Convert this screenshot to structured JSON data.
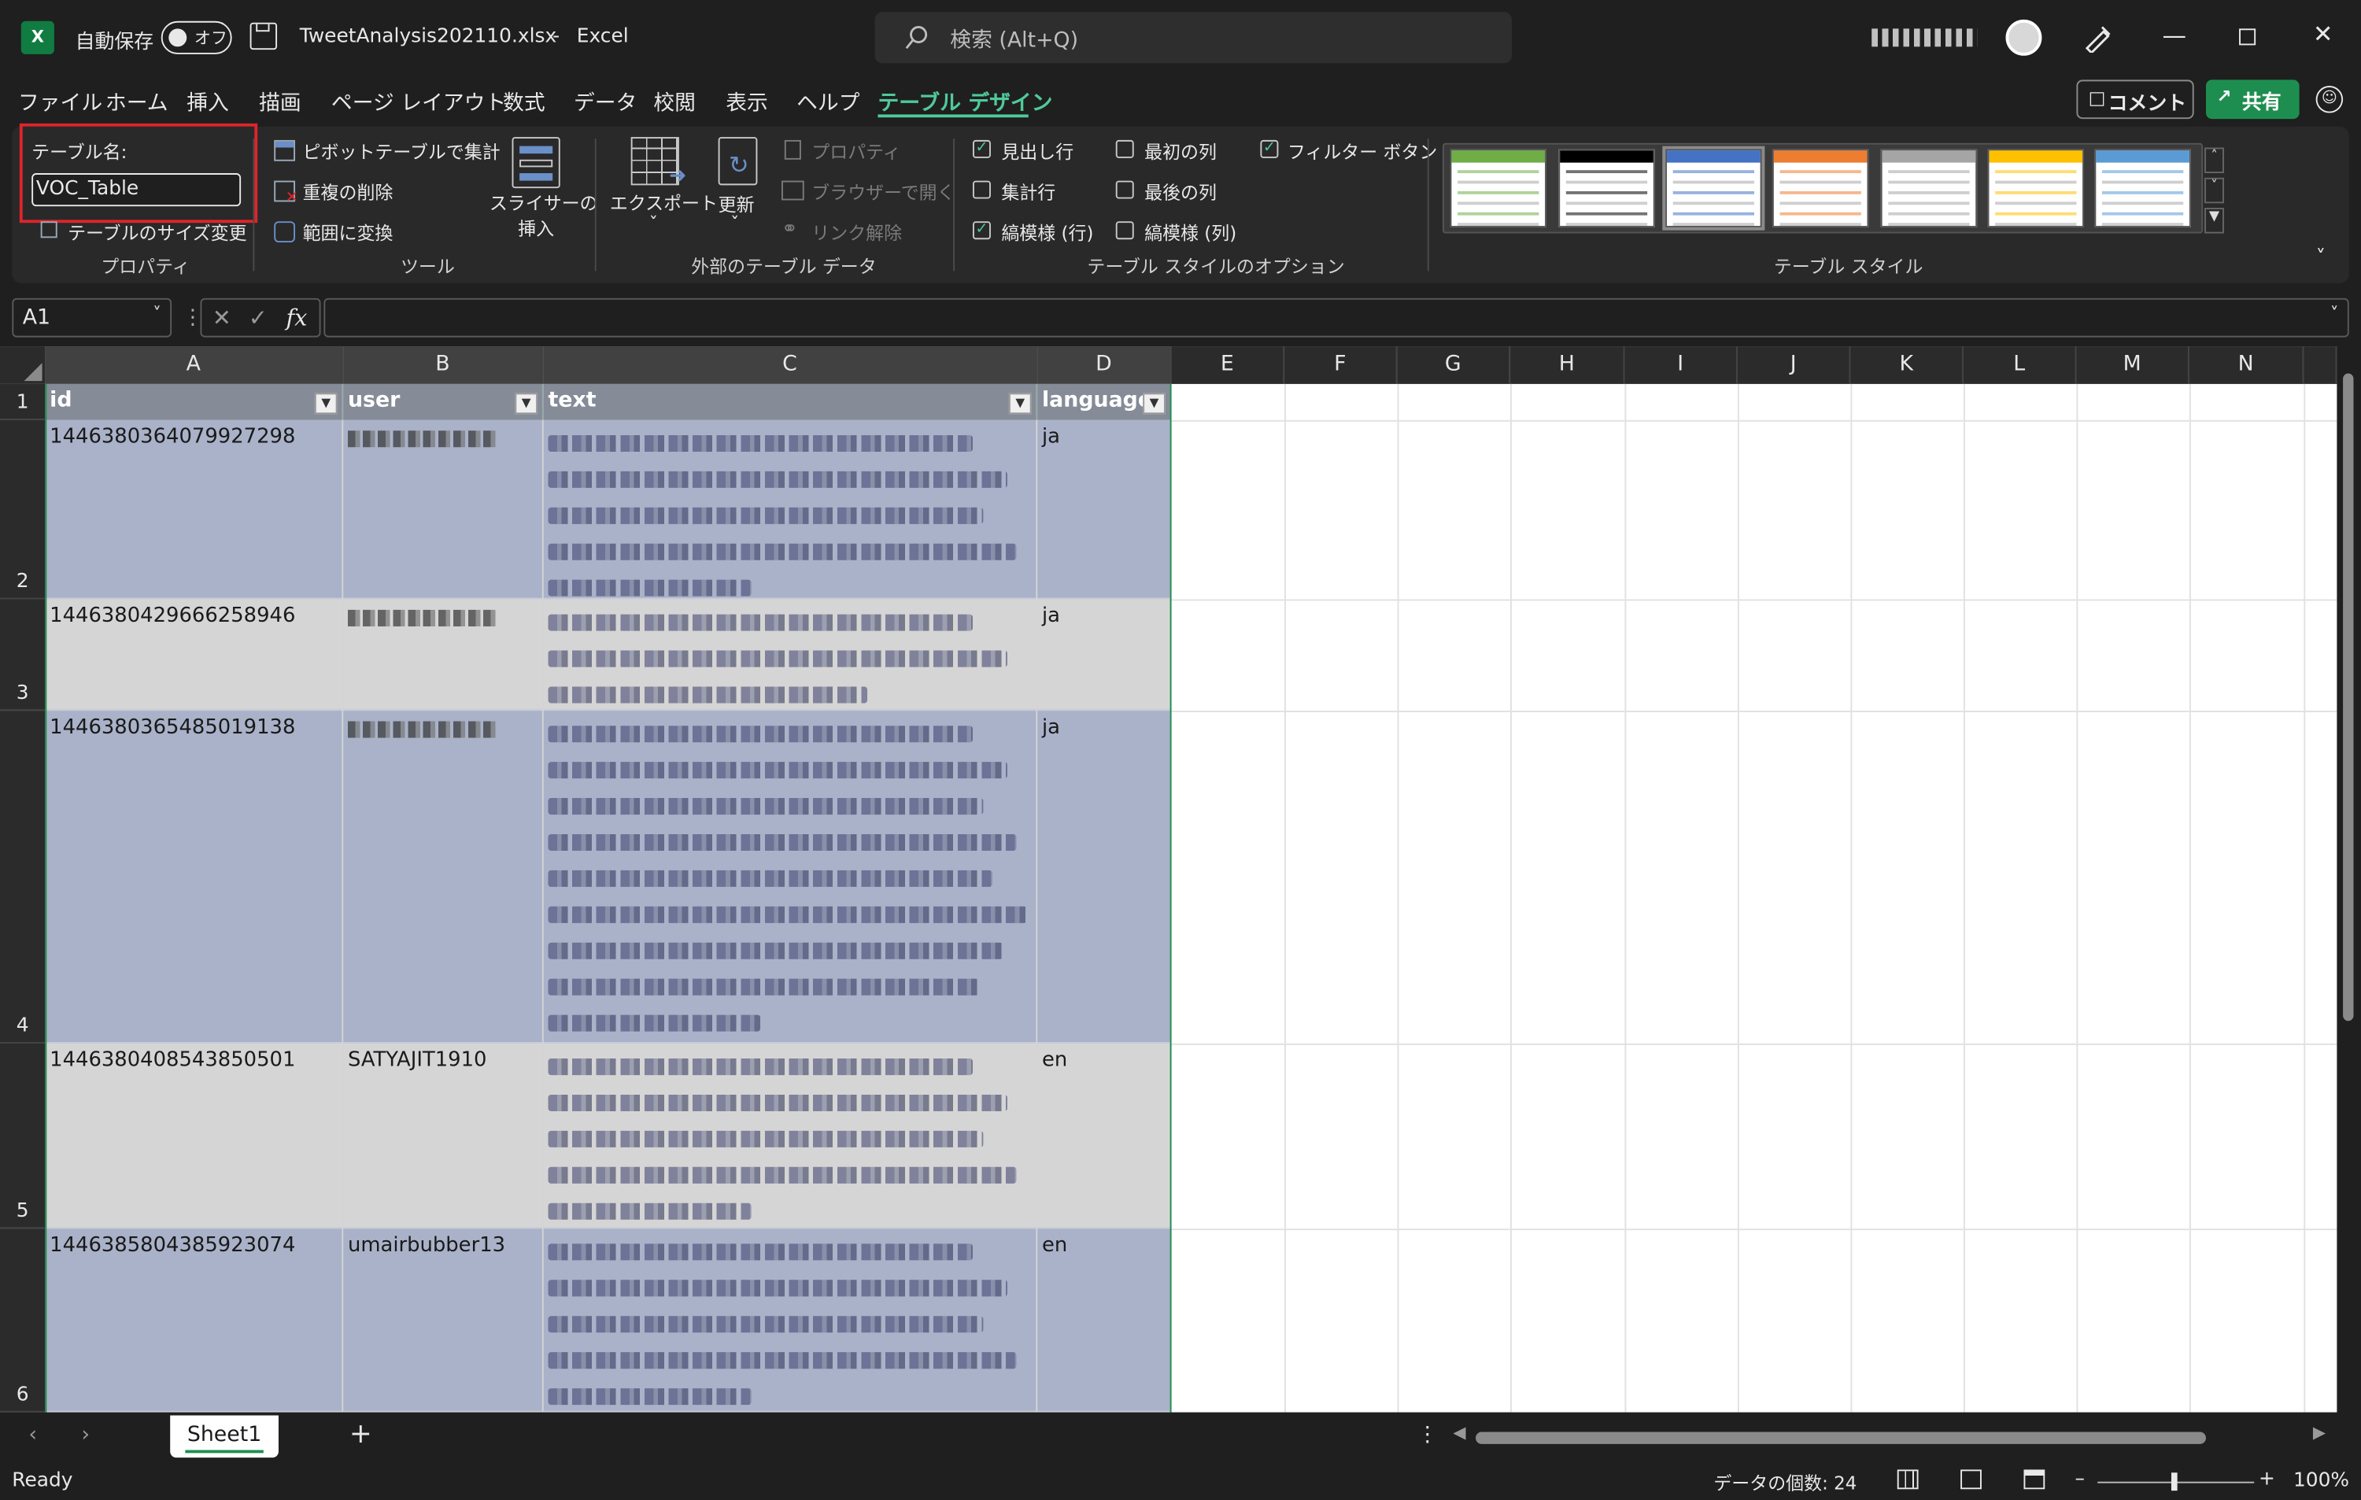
{
  "titlebar": {
    "autosave_label": "自動保存",
    "autosave_state": "オフ",
    "filename": "TweetAnalysis202110.xlsx",
    "separator": "-",
    "app_name": "Excel",
    "search_placeholder": "検索 (Alt+Q)",
    "user_name": "・・・・"
  },
  "menu": {
    "items": [
      "ファイル",
      "ホーム",
      "挿入",
      "描画",
      "ページ レイアウト",
      "数式",
      "データ",
      "校閲",
      "表示",
      "ヘルプ",
      "テーブル デザイン"
    ],
    "comment_label": "コメント",
    "share_label": "共有"
  },
  "ribbon": {
    "properties": {
      "table_name_label": "テーブル名:",
      "table_name_value": "VOC_Table",
      "resize_label": "テーブルのサイズ変更",
      "group_label": "プロパティ"
    },
    "tools": {
      "pivot_label": "ピボットテーブルで集計",
      "remove_dup_label": "重複の削除",
      "convert_range_label": "範囲に変換",
      "slicer_label_1": "スライサーの",
      "slicer_label_2": "挿入",
      "group_label": "ツール"
    },
    "external": {
      "export_label": "エクスポート",
      "refresh_label": "更新",
      "properties_label": "プロパティ",
      "open_browser_label": "ブラウザーで開く",
      "unlink_label": "リンク解除",
      "group_label": "外部のテーブル データ"
    },
    "style_options": {
      "header_row": "見出し行",
      "total_row": "集計行",
      "banded_rows": "縞模様 (行)",
      "first_column": "最初の列",
      "last_column": "最後の列",
      "banded_columns": "縞模様 (列)",
      "filter_button": "フィルター ボタン",
      "group_label": "テーブル スタイルのオプション"
    },
    "styles": {
      "group_label": "テーブル スタイル",
      "swatch_colors": [
        "#70ad47",
        "#000000",
        "#4472c4",
        "#ed7d31",
        "#a5a5a5",
        "#ffc000",
        "#5b9bd5"
      ]
    }
  },
  "formula_bar": {
    "name_box": "A1",
    "fx": "fx",
    "value": ""
  },
  "columns": [
    "A",
    "B",
    "C",
    "D",
    "E",
    "F",
    "G",
    "H",
    "I",
    "J",
    "K",
    "L",
    "M",
    "N"
  ],
  "table": {
    "headers": [
      "id",
      "user",
      "text",
      "language"
    ],
    "rows": [
      {
        "row": "2",
        "id": "1446380364079927298",
        "user": "・・・",
        "language": "ja"
      },
      {
        "row": "3",
        "id": "1446380429666258946",
        "user": "・・・",
        "language": "ja"
      },
      {
        "row": "4",
        "id": "1446380365485019138",
        "user": "・・・",
        "language": "ja"
      },
      {
        "row": "5",
        "id": "1446380408543850501",
        "user": "SATYAJIT1910",
        "language": "en"
      },
      {
        "row": "6",
        "id": "1446385804385923074",
        "user": "umairbubber13",
        "language": "en"
      }
    ]
  },
  "sheet": {
    "tab_label": "Sheet1",
    "add_label": "+"
  },
  "status": {
    "ready": "Ready",
    "count_label": "データの個数: 24",
    "zoom": "100%"
  }
}
